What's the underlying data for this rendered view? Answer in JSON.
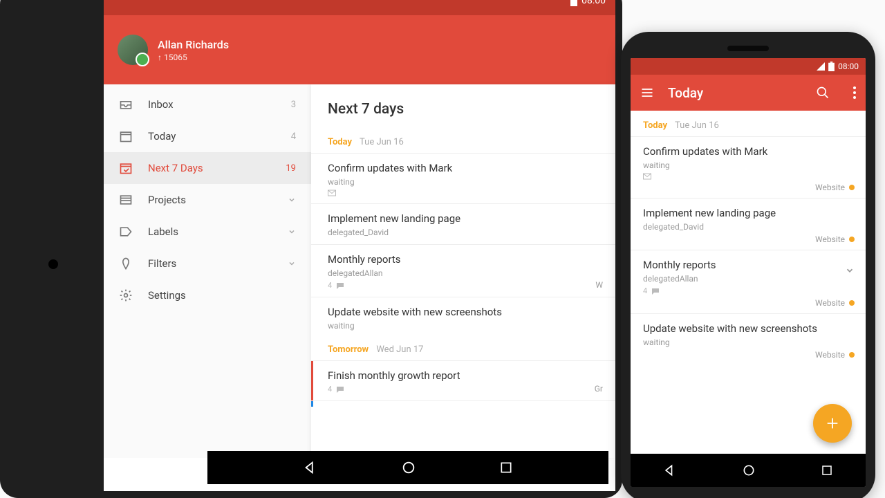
{
  "status_time": "08:00",
  "user": {
    "name": "Allan Richards",
    "points": "↑ 15065"
  },
  "sidebar": {
    "items": [
      {
        "label": "Inbox",
        "count": "3"
      },
      {
        "label": "Today",
        "count": "4"
      },
      {
        "label": "Next 7 Days",
        "count": "19"
      },
      {
        "label": "Projects"
      },
      {
        "label": "Labels"
      },
      {
        "label": "Filters"
      },
      {
        "label": "Settings"
      }
    ]
  },
  "tablet_main": {
    "title": "Next 7 days",
    "sections": [
      {
        "label": "Today",
        "date": "Tue Jun 16",
        "tasks": [
          {
            "title": "Confirm updates with Mark",
            "sub": "waiting",
            "meta_count": "",
            "has_mail": true
          },
          {
            "title": "Implement new landing page",
            "sub": "delegated_David"
          },
          {
            "title": "Monthly reports",
            "sub": "delegatedAllan",
            "meta_count": "4",
            "project_trunc": "W"
          },
          {
            "title": "Update website with new screenshots",
            "sub": "waiting"
          }
        ]
      },
      {
        "label": "Tomorrow",
        "date": "Wed Jun 17",
        "tasks": [
          {
            "title": "Finish monthly growth report",
            "meta_count": "4",
            "priority": 1,
            "project_trunc": "Gr"
          }
        ]
      }
    ]
  },
  "phone": {
    "title": "Today",
    "section": {
      "label": "Today",
      "date": "Tue Jun 16"
    },
    "tasks": [
      {
        "title": "Confirm updates with Mark",
        "sub": "waiting",
        "has_mail": true,
        "project": "Website"
      },
      {
        "title": "Implement new landing page",
        "sub": "delegated_David",
        "project": "Website"
      },
      {
        "title": "Monthly reports",
        "sub": "delegatedAllan",
        "meta_count": "4",
        "project": "Website",
        "expandable": true
      },
      {
        "title": "Update website with new screenshots",
        "sub": "waiting",
        "project": "Website"
      }
    ]
  }
}
